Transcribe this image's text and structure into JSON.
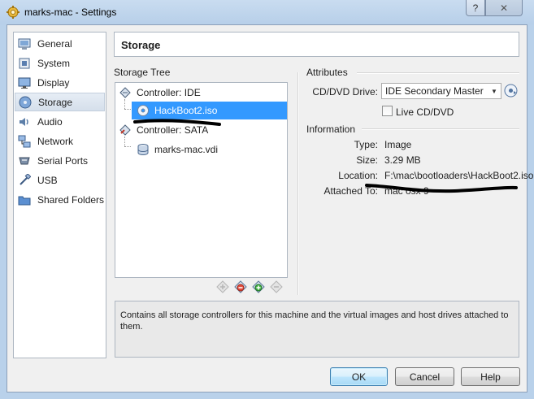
{
  "window": {
    "title": "marks-mac - Settings",
    "help_label": "?",
    "close_label": "✕"
  },
  "nav": {
    "items": [
      {
        "label": "General",
        "icon": "general-icon"
      },
      {
        "label": "System",
        "icon": "system-icon"
      },
      {
        "label": "Display",
        "icon": "display-icon"
      },
      {
        "label": "Storage",
        "icon": "storage-icon",
        "selected": true
      },
      {
        "label": "Audio",
        "icon": "audio-icon"
      },
      {
        "label": "Network",
        "icon": "network-icon"
      },
      {
        "label": "Serial Ports",
        "icon": "serial-ports-icon"
      },
      {
        "label": "USB",
        "icon": "usb-icon"
      },
      {
        "label": "Shared Folders",
        "icon": "shared-folders-icon"
      }
    ]
  },
  "page": {
    "title": "Storage"
  },
  "storage_tree": {
    "label": "Storage Tree",
    "controller_ide": "Controller: IDE",
    "ide_item": "HackBoot2.iso",
    "controller_sata": "Controller: SATA",
    "sata_item": "marks-mac.vdi"
  },
  "attributes": {
    "label": "Attributes",
    "cd_drive_label": "CD/DVD Drive:",
    "cd_drive_value": "IDE Secondary Master",
    "live_cd_label": "Live CD/DVD",
    "live_cd_checked": false
  },
  "information": {
    "label": "Information",
    "type_label": "Type:",
    "type_value": "Image",
    "size_label": "Size:",
    "size_value": "3.29 MB",
    "location_label": "Location:",
    "location_value": "F:\\mac\\bootloaders\\HackBoot2.iso",
    "attached_label": "Attached To:",
    "attached_value": "mac osx 9"
  },
  "description": "Contains all storage controllers for this machine and the virtual images and host drives attached to them.",
  "buttons": {
    "ok": "OK",
    "cancel": "Cancel",
    "help": "Help"
  },
  "colors": {
    "selection": "#3399ff",
    "title_bar": "#b9d1ea"
  }
}
